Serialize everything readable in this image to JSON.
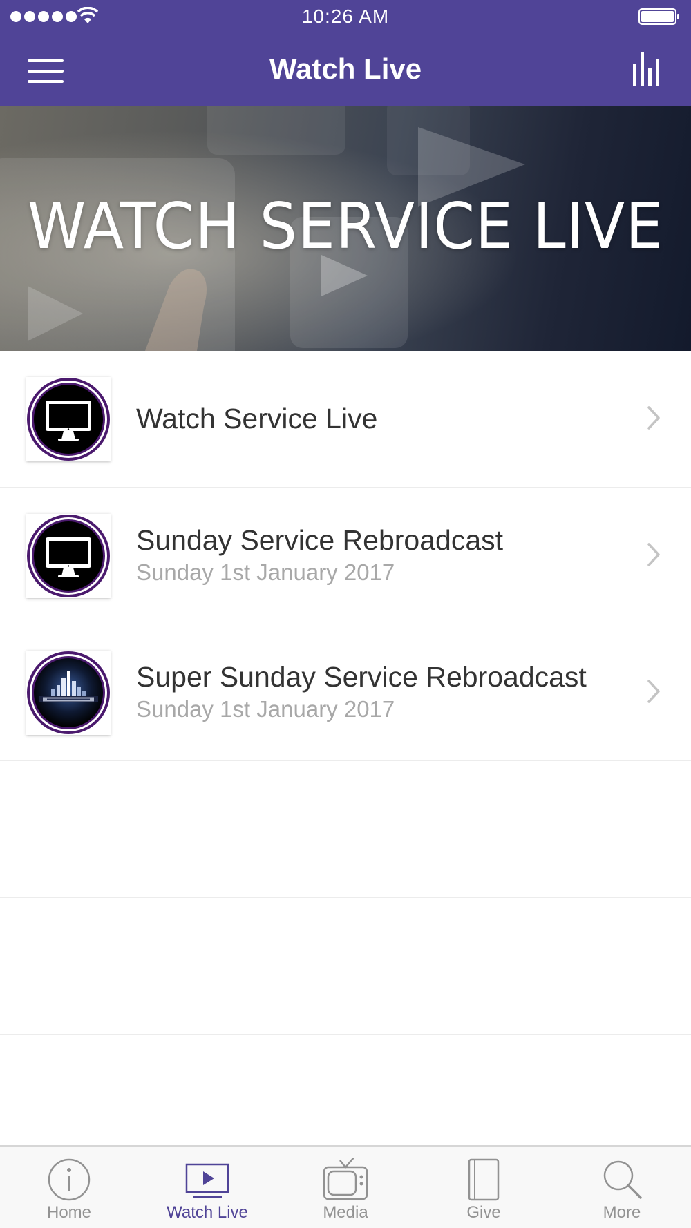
{
  "status_bar": {
    "time": "10:26 AM"
  },
  "nav": {
    "title": "Watch Live"
  },
  "banner": {
    "text": "WATCH SERVICE LIVE"
  },
  "list": {
    "items": [
      {
        "title": "Watch Service Live",
        "subtitle": "",
        "icon": "monitor-icon"
      },
      {
        "title": "Sunday Service Rebroadcast",
        "subtitle": "Sunday 1st January 2017",
        "icon": "monitor-icon"
      },
      {
        "title": "Super Sunday Service Rebroadcast",
        "subtitle": "Sunday 1st January 2017",
        "icon": "super-sunday-logo"
      }
    ]
  },
  "tabs": [
    {
      "label": "Home",
      "icon": "info-icon",
      "active": false
    },
    {
      "label": "Watch Live",
      "icon": "play-screen-icon",
      "active": true
    },
    {
      "label": "Media",
      "icon": "tv-icon",
      "active": false
    },
    {
      "label": "Give",
      "icon": "tablet-icon",
      "active": false
    },
    {
      "label": "More",
      "icon": "search-icon",
      "active": false
    }
  ],
  "colors": {
    "brand": "#504497",
    "thumb_ring": "#4b1a6e",
    "active_tab": "#504497",
    "inactive_tab": "#929292"
  }
}
